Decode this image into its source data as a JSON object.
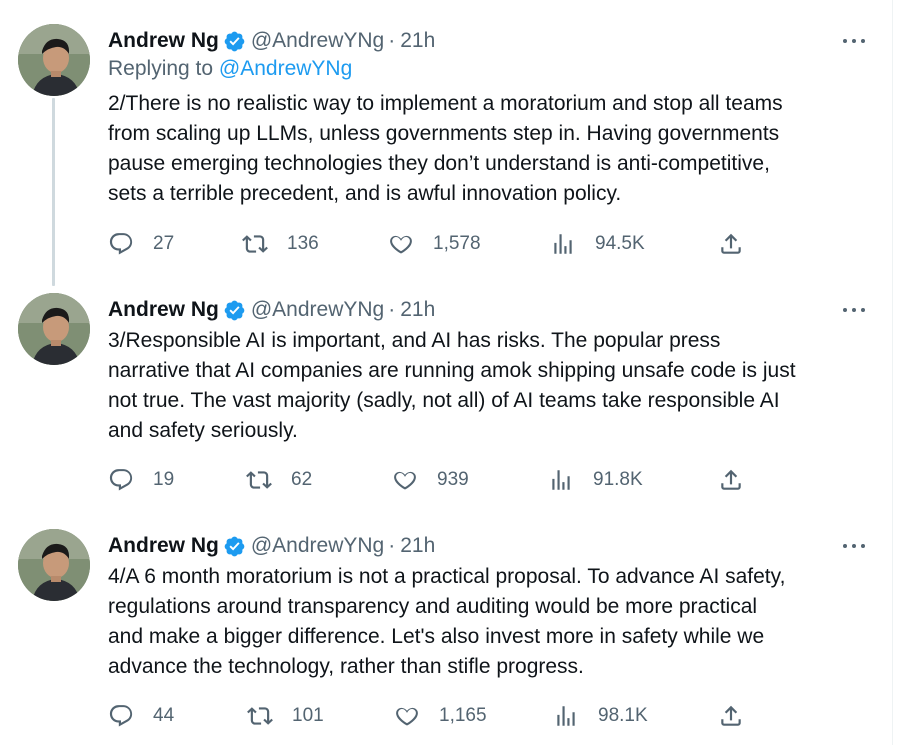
{
  "thread": {
    "tweets": [
      {
        "author_name": "Andrew Ng",
        "handle": "@AndrewYNg",
        "separator": "·",
        "time": "21h",
        "replying_prefix": "Replying to ",
        "replying_to": "@AndrewYNg",
        "lines": [
          "2/There is no realistic way to implement a moratorium and stop all teams",
          "from scaling up LLMs, unless governments step in. Having governments",
          "pause emerging technologies they don’t understand is anti-competitive,",
          "sets a terrible precedent, and is awful innovation policy."
        ],
        "replies": "27",
        "retweets": "136",
        "likes": "1,578",
        "views": "94.5K"
      },
      {
        "author_name": "Andrew Ng",
        "handle": "@AndrewYNg",
        "separator": "·",
        "time": "21h",
        "lines": [
          "3/Responsible AI is important, and AI has risks. The popular press",
          "narrative that AI companies are running amok shipping unsafe code is just",
          "not true. The vast majority (sadly, not all) of AI teams take responsible AI",
          "and safety seriously."
        ],
        "replies": "19",
        "retweets": "62",
        "likes": "939",
        "views": "91.8K"
      },
      {
        "author_name": "Andrew Ng",
        "handle": "@AndrewYNg",
        "separator": "·",
        "time": "21h",
        "lines": [
          "4/A 6 month moratorium is not a practical proposal. To advance AI safety,",
          "regulations around transparency and auditing would be more practical",
          "and make a bigger difference. Let's also invest more in safety while we",
          "advance the technology, rather than stifle progress."
        ],
        "replies": "44",
        "retweets": "101",
        "likes": "1,165",
        "views": "98.1K"
      }
    ]
  },
  "icons": {
    "verified": "verified-badge-icon",
    "more": "more-dots-icon",
    "reply": "reply-bubble-icon",
    "retweet": "retweet-icon",
    "like": "heart-icon",
    "views": "views-bars-icon",
    "share": "share-upload-icon"
  },
  "colors": {
    "text": "#0f1419",
    "secondary": "#536471",
    "link": "#1d9bf0",
    "verified": "#1d9bf0",
    "thread_line": "#cfd9de"
  }
}
